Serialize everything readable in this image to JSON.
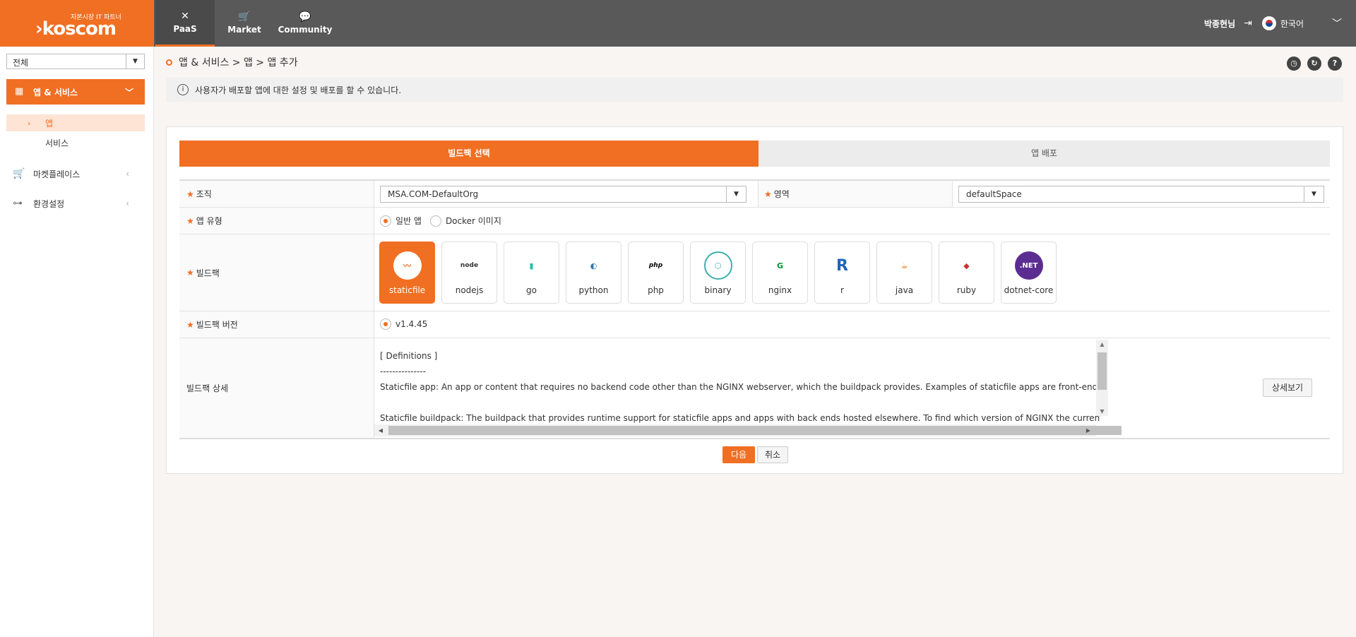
{
  "header": {
    "logo_tagline": "자본시장 IT 파트너",
    "logo_text": "koscom",
    "nav": [
      {
        "label": "PaaS",
        "icon": "tools-icon"
      },
      {
        "label": "Market",
        "icon": "cart-icon"
      },
      {
        "label": "Community",
        "icon": "chat-icon"
      }
    ],
    "user_name": "박종현님",
    "language": "한국어"
  },
  "sidebar": {
    "scope_select": "전체",
    "active_menu": "앱 & 서비스",
    "sub_items": [
      {
        "label": "앱",
        "active": true
      },
      {
        "label": "서비스",
        "active": false
      }
    ],
    "items": [
      {
        "label": "마켓플레이스",
        "icon": "cart-icon"
      },
      {
        "label": "환경설정",
        "icon": "settings-tree-icon"
      }
    ]
  },
  "main": {
    "breadcrumb": "앱 & 서비스 > 앱 > 앱 추가",
    "info_text": "사용자가 배포할 앱에 대한 설정 및 배포를 할 수 있습니다.",
    "steps": [
      "빌드팩 선택",
      "앱 배포"
    ],
    "form": {
      "org_label": "조직",
      "org_value": "MSA.COM-DefaultOrg",
      "space_label": "영역",
      "space_value": "defaultSpace",
      "app_type_label": "앱 유형",
      "app_type_options": [
        "일반 앱",
        "Docker 이미지"
      ],
      "app_type_selected": "일반 앱",
      "buildpack_label": "빌드팩",
      "buildpacks": [
        "staticfile",
        "nodejs",
        "go",
        "python",
        "php",
        "binary",
        "nginx",
        "r",
        "java",
        "ruby",
        "dotnet-core"
      ],
      "buildpack_selected": "staticfile",
      "version_label": "빌드팩 버전",
      "version_value": "v1.4.45",
      "detail_label": "빌드팩 상세",
      "detail_lines": [
        "[ Definitions ]",
        "---------------",
        "Staticfile app: An app or content that requires no backend code other than the NGINX webserver, which the buildpack provides. Examples of staticfile apps are front-end JavaScript apps, static HTML content, and",
        "",
        "Staticfile buildpack: The buildpack that provides runtime support for staticfile apps and apps with back ends hosted elsewhere. To find which version of NGINX the current Staticfile buildpack uses, see the Staticfi"
      ],
      "detail_button": "상세보기"
    },
    "buttons": {
      "next": "다음",
      "cancel": "취소"
    }
  },
  "colors": {
    "accent": "#f06f22",
    "topbar": "#595959"
  }
}
